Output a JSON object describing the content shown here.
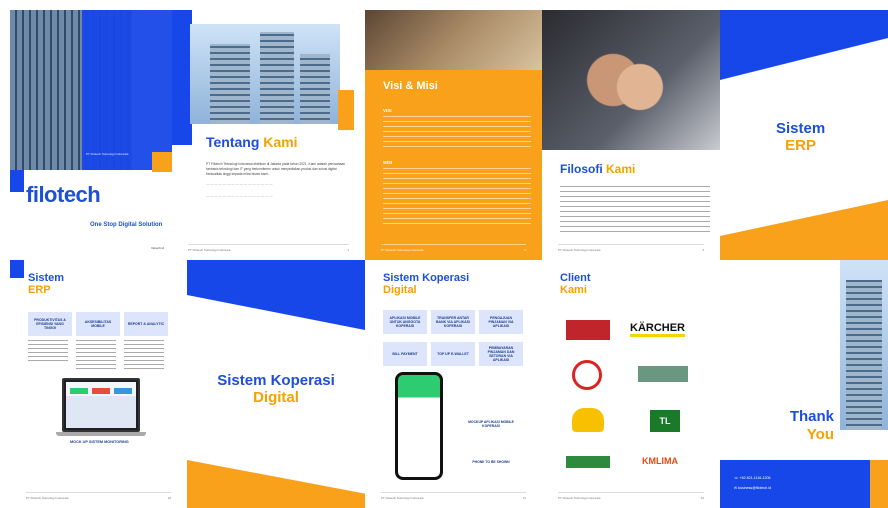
{
  "p1": {
    "footer_left": "PT Filotech Teknologi Indonesia",
    "logo": "filotech",
    "tagline": "One Stop Digital Solution",
    "web": "filotech.id"
  },
  "p2": {
    "title_a": "Tentang",
    "title_b": "Kami",
    "body": "PT Filotech Teknologi Indonesia didirikan di Jakarta pada tahun 2021. Kami adalah perusahaan berbasis teknologi dan IT yang berkomitmen untuk menyediakan produk dan solusi digital berkualitas tinggi kepada mitra bisnis kami.",
    "footer": "PT Filotech Teknologi Indonesia",
    "page": "1"
  },
  "p3": {
    "title": "Visi & Misi",
    "visi": "VISI",
    "misi": "MISI",
    "footer": "PT Filotech Teknologi Indonesia",
    "page": "2"
  },
  "p4": {
    "title_a": "Filosofi",
    "title_b": "Kami",
    "footer": "PT Filotech Teknologi Indonesia",
    "page": "3"
  },
  "p5": {
    "title_a": "Sistem",
    "title_b": "ERP"
  },
  "p6": {
    "title_a": "Sistem",
    "title_b": "ERP",
    "boxes": [
      "PRODUKTIVITAS & EFISIENSI YANG TINGGI",
      "AKSESIBILITAS MOBILE",
      "REPORT & ANALYTIC"
    ],
    "caption": "MOCK UP SISTEM MONITORING",
    "footer": "PT Filotech Teknologi Indonesia",
    "page": "10"
  },
  "p7": {
    "title_a": "Sistem Koperasi",
    "title_b": "Digital"
  },
  "p8": {
    "title_a": "Sistem Koperasi",
    "title_b": "Digital",
    "boxes": [
      "APLIKASI MOBILE UNTUK ANGGOTA KOPERASI",
      "TRANSFER ANTAR BANK VIA APLIKASI KOPERASI",
      "PENGAJUAN PINJAMAN VIA APLIKASI",
      "BILL PAYMENT",
      "TOP UP E-WALLET",
      "PEMBAYARAN PINJAMAN DAN SETORAN VIA APLIKASI"
    ],
    "mock1": "MOCKUP APLIKASI MOBILE KOPERASI",
    "mock2": "PHONE TO BE SHOWN",
    "footer": "PT Filotech Teknologi Indonesia",
    "page": "11"
  },
  "p9": {
    "title_a": "Client",
    "title_b": "Kami",
    "clients": [
      "KÄRCHER",
      "TL",
      "KMLIMA"
    ],
    "footer": "PT Filotech Teknologi Indonesia",
    "page": "16"
  },
  "p10": {
    "title_a": "Thank",
    "title_b": "You",
    "phone": "+62 821-1116-1206",
    "email": "business@filotech.id"
  }
}
